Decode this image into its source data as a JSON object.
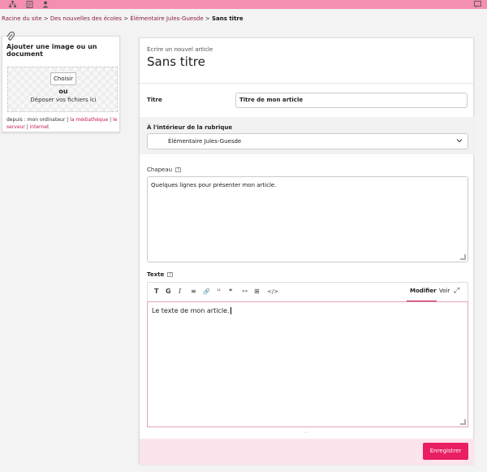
{
  "topbar": {
    "icons": [
      "sitemap-icon",
      "document-icon",
      "user-add-icon",
      "chat-icon"
    ]
  },
  "breadcrumb": {
    "items": [
      "Racine du site",
      "Des nouvelles des écoles",
      "Élémentaire Jules-Guesde"
    ],
    "separator": ">",
    "current": "Sans titre"
  },
  "sidebar": {
    "title": "Ajouter une image ou un document",
    "choose_label": "Choisir",
    "or_label": "ou",
    "drop_label": "Déposer vos fichiers ici",
    "from_prefix": "depuis :",
    "sources": [
      "mon ordinateur",
      "la médiathèque",
      "le serveur",
      "internet"
    ]
  },
  "form": {
    "subtitle": "Écrire un nouvel article",
    "heading": "Sans titre",
    "titre_label": "Titre",
    "titre_value": "Titre de mon article",
    "rubrique_label": "À l'intérieur de la rubrique",
    "rubrique_value": "Élémentaire Jules-Guesde",
    "chapeau_label": "Chapeau",
    "chapeau_value": "Quelques lignes pour présenter mon article.",
    "texte_label": "Texte",
    "texte_value": "Le texte de mon article.",
    "help_glyph": "?",
    "toolbar": {
      "buttons": [
        "T",
        "G",
        "I",
        "≡",
        "🔗",
        "¹²",
        "❝",
        "«»",
        "⊞",
        "</>"
      ],
      "modifier": "Modifier",
      "voir": "Voir",
      "fullscreen": "⤢"
    },
    "save_label": "Enregistrer"
  },
  "colors": {
    "accent": "#e91e63",
    "topbar": "#f48fb1",
    "footer": "#fce4ec"
  }
}
